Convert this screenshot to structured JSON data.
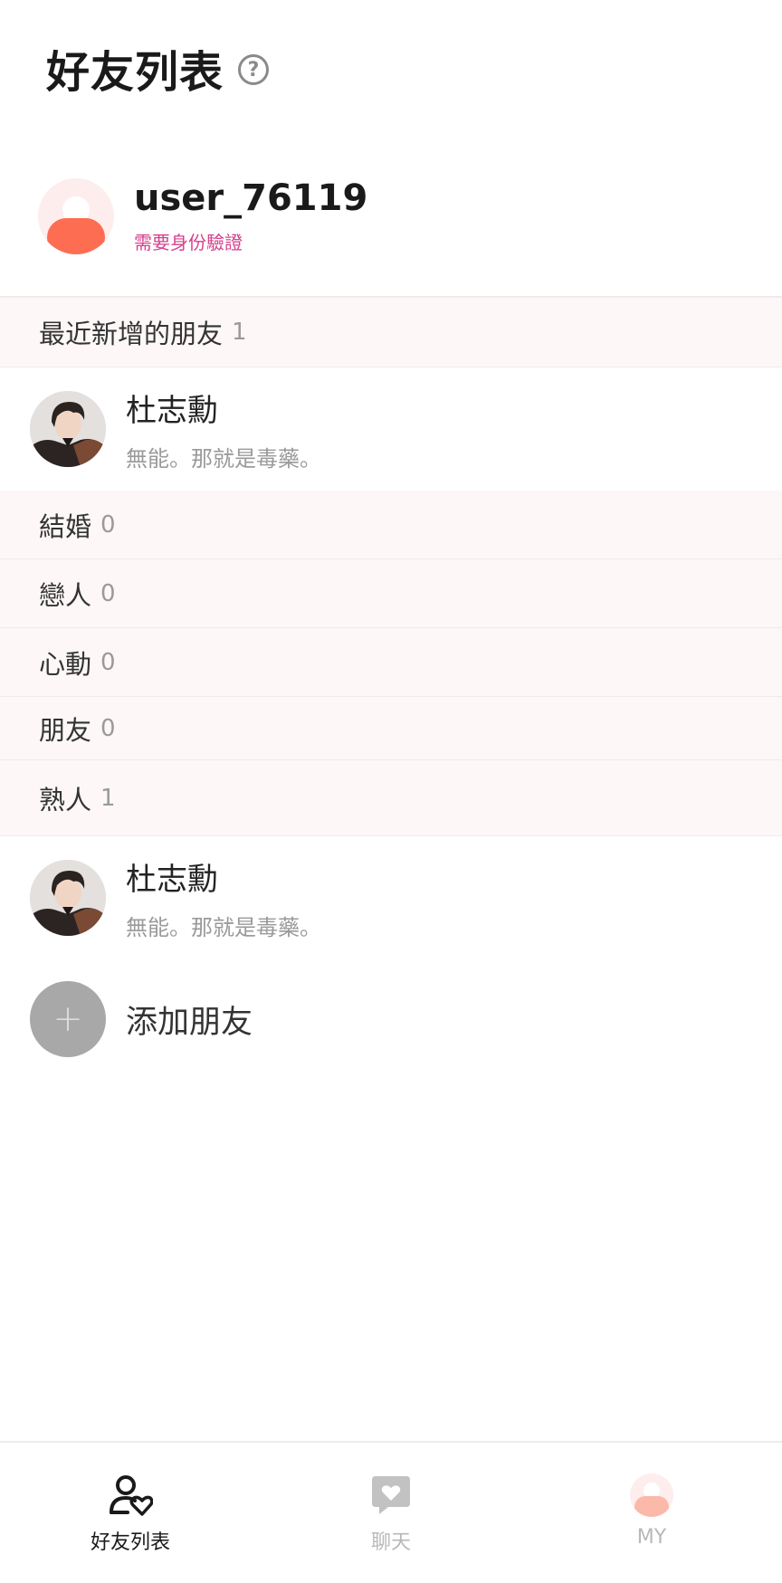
{
  "header": {
    "title": "好友列表",
    "help_icon": "help-circle-icon",
    "help_glyph": "?"
  },
  "profile": {
    "username": "user_76119",
    "verify_text": "需要身份驗證"
  },
  "sections": {
    "recent": {
      "label": "最近新增的朋友",
      "count": "1"
    },
    "married": {
      "label": "結婚",
      "count": "0"
    },
    "lovers": {
      "label": "戀人",
      "count": "0"
    },
    "crush": {
      "label": "心動",
      "count": "0"
    },
    "friends": {
      "label": "朋友",
      "count": "0"
    },
    "acquaintances": {
      "label": "熟人",
      "count": "1"
    }
  },
  "recent_friend": {
    "name": "杜志勳",
    "status": "無能。那就是毒藥。"
  },
  "acquaintance_friend": {
    "name": "杜志勳",
    "status": "無能。那就是毒藥。"
  },
  "add_friend": {
    "glyph": "+",
    "label": "添加朋友"
  },
  "bottom_nav": {
    "friends_label": "好友列表",
    "chat_label": "聊天",
    "my_label": "MY"
  },
  "colors": {
    "accent_pink": "#d63f8c",
    "avatar_orange": "#fd6d52",
    "section_bg": "#fdf7f7"
  }
}
